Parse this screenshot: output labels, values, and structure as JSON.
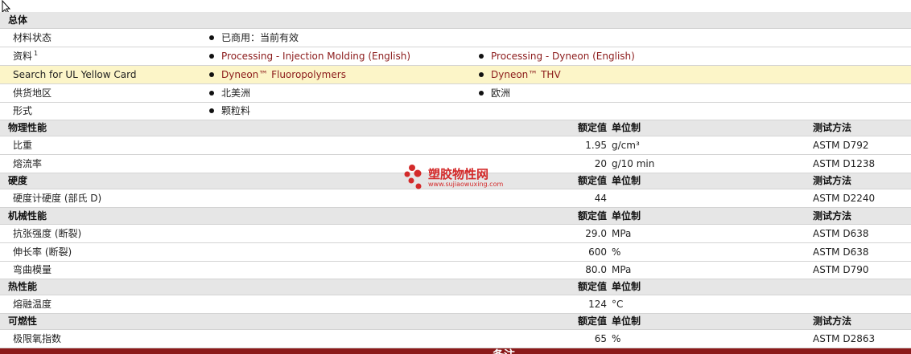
{
  "sections": {
    "general": "总体",
    "physical": "物理性能",
    "hardness": "硬度",
    "mechanical": "机械性能",
    "thermal": "热性能",
    "flammability": "可燃性"
  },
  "headers": {
    "rated": "额定值",
    "unit": "单位制",
    "test": "测试方法"
  },
  "general": {
    "material_status_label": "材料状态",
    "material_status_value": "已商用：当前有效",
    "docs_label": "资料",
    "docs_sup": "1",
    "docs_link1": "Processing - Injection Molding (English)",
    "docs_link2": "Processing - Dyneon (English)",
    "ul_label": "Search for UL Yellow Card",
    "ul_link1": "Dyneon™ Fluoropolymers",
    "ul_link2": "Dyneon™ THV",
    "supply_label": "供货地区",
    "supply_1": "北美洲",
    "supply_2": "欧洲",
    "form_label": "形式",
    "form_value": "颗粒料"
  },
  "properties": {
    "specific_gravity": {
      "label": "比重",
      "value": "1.95",
      "unit": "g/cm³",
      "test": "ASTM D792"
    },
    "melt_flow": {
      "label": "熔流率",
      "value": "20",
      "unit": "g/10 min",
      "test": "ASTM D1238"
    },
    "durometer": {
      "label": "硬度计硬度 (部氏 D)",
      "value": "44",
      "unit": "",
      "test": "ASTM D2240"
    },
    "tensile_strength": {
      "label": "抗张强度 (断裂)",
      "value": "29.0",
      "unit": "MPa",
      "test": "ASTM D638"
    },
    "elongation": {
      "label": "伸长率 (断裂)",
      "value": "600",
      "unit": "%",
      "test": "ASTM D638"
    },
    "flex_modulus": {
      "label": "弯曲模量",
      "value": "80.0",
      "unit": "MPa",
      "test": "ASTM D790"
    },
    "melting_temp": {
      "label": "熔融温度",
      "value": "124",
      "unit": "°C",
      "test": ""
    },
    "loi": {
      "label": "极限氧指数",
      "value": "65",
      "unit": "%",
      "test": "ASTM D2863"
    }
  },
  "watermark": {
    "title": "塑胶物性网",
    "url": "www.sujiaowuxing.com"
  },
  "footer_partial": "备注",
  "colors": {
    "accent": "#8b1a1a",
    "section_bg": "#e6e6e6",
    "highlight_bg": "#fcf5c8"
  }
}
